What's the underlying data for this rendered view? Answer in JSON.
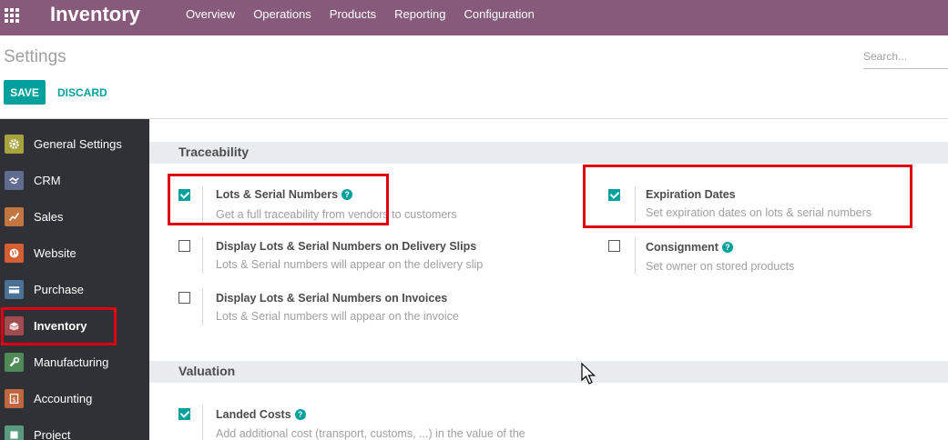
{
  "navbar": {
    "app_title": "Inventory",
    "menu": [
      "Overview",
      "Operations",
      "Products",
      "Reporting",
      "Configuration"
    ],
    "apps_icon": "apps-grid-icon",
    "bg_color": "#875a7b"
  },
  "control_panel": {
    "title": "Settings",
    "search_placeholder": "Search...",
    "save_label": "SAVE",
    "discard_label": "DISCARD"
  },
  "sidebar": {
    "items": [
      {
        "label": "General Settings",
        "icon": "gear-icon",
        "color": "#a9a33f"
      },
      {
        "label": "CRM",
        "icon": "handshake-icon",
        "color": "#5f6b8f"
      },
      {
        "label": "Sales",
        "icon": "chart-line-icon",
        "color": "#c3763f"
      },
      {
        "label": "Website",
        "icon": "globe-icon",
        "color": "#d35f33"
      },
      {
        "label": "Purchase",
        "icon": "credit-card-icon",
        "color": "#4a7196"
      },
      {
        "label": "Inventory",
        "icon": "box-icon",
        "color": "#a24b4e",
        "active": true
      },
      {
        "label": "Manufacturing",
        "icon": "wrench-icon",
        "color": "#4f8a57"
      },
      {
        "label": "Accounting",
        "icon": "invoice-icon",
        "color": "#c0673f"
      },
      {
        "label": "Project",
        "icon": "puzzle-icon",
        "color": "#5a9a7f"
      }
    ]
  },
  "traceability": {
    "title": "Traceability",
    "settings": [
      {
        "title": "Lots & Serial Numbers",
        "desc": "Get a full traceability from vendors to customers",
        "checked": true,
        "help": true
      },
      {
        "title": "Expiration Dates",
        "desc": "Set expiration dates on lots & serial numbers",
        "checked": true,
        "help": false
      },
      {
        "title": "Display Lots & Serial Numbers on Delivery Slips",
        "desc": "Lots & Serial numbers will appear on the delivery slip",
        "checked": false,
        "help": false
      },
      {
        "title": "Consignment",
        "desc": "Set owner on stored products",
        "checked": false,
        "help": true
      },
      {
        "title": "Display Lots & Serial Numbers on Invoices",
        "desc": "Lots & Serial numbers will appear on the invoice",
        "checked": false,
        "help": false
      }
    ]
  },
  "valuation": {
    "title": "Valuation",
    "settings": [
      {
        "title": "Landed Costs",
        "desc": "Add additional cost (transport, customs, ...) in the value of the",
        "checked": true,
        "help": true
      }
    ]
  },
  "colors": {
    "accent": "#00a09d",
    "highlight": "#e0000f",
    "sidebar_bg": "#2f3136"
  },
  "help_glyph": "?"
}
